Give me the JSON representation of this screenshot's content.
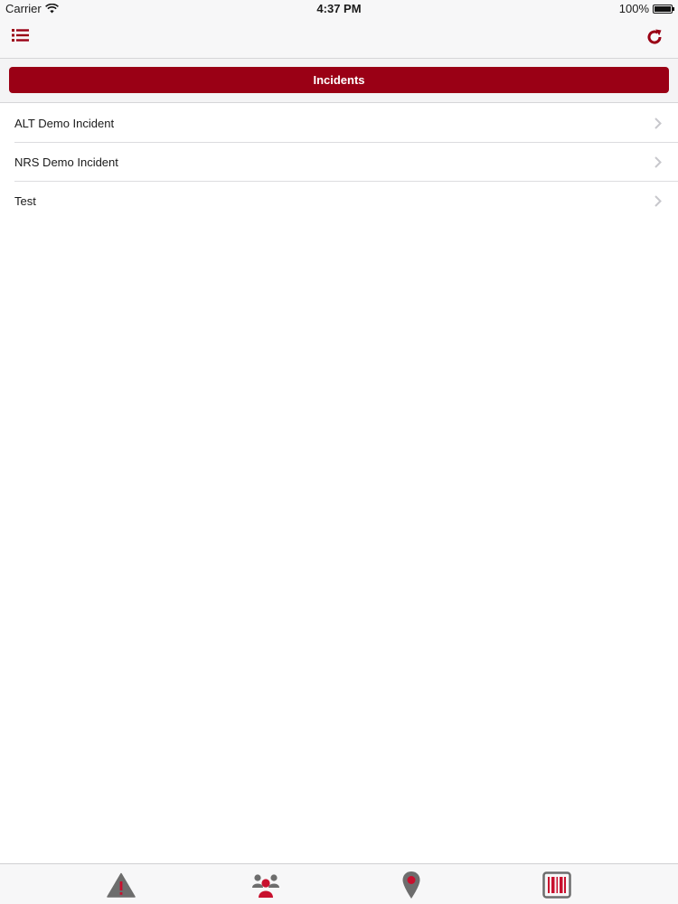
{
  "status_bar": {
    "carrier": "Carrier",
    "time": "4:37 PM",
    "battery": "100%",
    "battery_level": 1.0
  },
  "nav_bar": {
    "left_icon": "list-menu-icon",
    "right_icon": "refresh-icon"
  },
  "header": {
    "title": "Incidents"
  },
  "incidents": [
    {
      "label": "ALT Demo Incident"
    },
    {
      "label": "NRS Demo Incident"
    },
    {
      "label": "Test"
    }
  ],
  "tab_bar": {
    "tabs": [
      {
        "icon": "warning-icon"
      },
      {
        "icon": "people-icon"
      },
      {
        "icon": "location-pin-icon"
      },
      {
        "icon": "barcode-icon"
      }
    ]
  },
  "colors": {
    "accent": "#9a0015",
    "tab_gray": "#6d6d6d",
    "tab_red": "#c8102e",
    "chevron": "#c7c7cc"
  }
}
